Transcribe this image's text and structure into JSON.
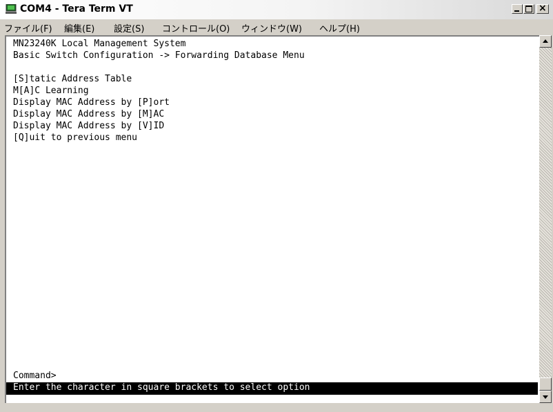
{
  "window": {
    "title": "COM4 - Tera Term VT",
    "close_glyph": "×"
  },
  "menu": [
    {
      "label": "ファイル(F)"
    },
    {
      "label": "編集(E)"
    },
    {
      "label": "設定(S)"
    },
    {
      "label": "コントロール(O)"
    },
    {
      "label": "ウィンドウ(W)"
    },
    {
      "label": "ヘルプ(H)"
    }
  ],
  "terminal": {
    "lines": [
      "MN23240K Local Management System",
      "Basic Switch Configuration -> Forwarding Database Menu",
      "",
      "[S]tatic Address Table",
      "M[A]C Learning",
      "Display MAC Address by [P]ort",
      "Display MAC Address by [M]AC",
      "Display MAC Address by [V]ID",
      "[Q]uit to previous menu"
    ],
    "prompt": "Command>",
    "status": "Enter the character in square brackets to select option"
  },
  "colors": {
    "terminal_bg": "#ffffff",
    "terminal_fg": "#000000",
    "status_bg": "#000000",
    "status_fg": "#ffffff",
    "chrome": "#d4d0c8"
  },
  "icons": [
    "terminal-app-icon",
    "minimize-icon",
    "maximize-icon",
    "close-icon",
    "scroll-up-arrow-icon",
    "scroll-down-arrow-icon"
  ]
}
